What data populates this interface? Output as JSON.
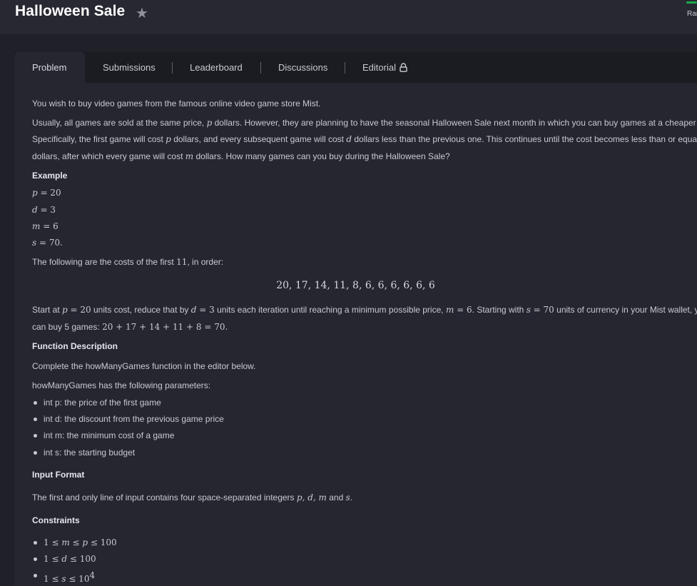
{
  "header": {
    "title": "Halloween Sale",
    "star_icon": "star-icon",
    "rank_label": "Ran"
  },
  "tabs": [
    {
      "label": "Problem"
    },
    {
      "label": "Submissions"
    },
    {
      "label": "Leaderboard"
    },
    {
      "label": "Discussions"
    },
    {
      "label": "Editorial"
    }
  ],
  "problem": {
    "intro": "You wish to buy video games from the famous online video game store Mist.",
    "para1": {
      "l1a": "Usually, all games are sold at the same price, ",
      "l1p": "p",
      "l1b": " dollars. However, they are planning to have the seasonal Halloween Sale next month in which you can buy games at a cheaper price.",
      "l2a": "Specifically, the first game will cost ",
      "l2p": "p",
      "l2b": " dollars, and every subsequent game will cost ",
      "l2d": "d",
      "l2c": " dollars less than the previous one. This continues until the cost becomes less than or equal to ",
      "l2m": "m",
      "l3m": "m",
      "l3a": "dollars, after which every game will cost ",
      "l3b": " dollars. How many games can you buy during the Halloween Sale?"
    },
    "example_heading": "Example",
    "example_vals": [
      {
        "var": "p",
        "val": " = 20"
      },
      {
        "var": "d",
        "val": " = 3"
      },
      {
        "var": "m",
        "val": " = 6"
      },
      {
        "var": "s",
        "val": " = 70."
      }
    ],
    "costs_text_a": "The following are the costs of the first ",
    "costs_text_n": "11",
    "costs_text_b": ", in order:",
    "costs_formula": "20, 17, 14, 11, 8, 6, 6, 6, 6, 6, 6",
    "start": {
      "a": "Start at ",
      "p": "p",
      "b": " = 20",
      "c": " units cost, reduce that by ",
      "d": "d",
      "e": " = 3",
      "f": " units each iteration until reaching a minimum possible price, ",
      "m": "m",
      "g": " = 6",
      "h": ". Starting with ",
      "s": "s",
      "i": " = 70",
      "j": " units of currency in your Mist wallet, you",
      "k": "can buy 5 games: ",
      "sum": "20 + 17 + 14 + 11 + 8 = 70."
    },
    "function_heading": "Function Description",
    "function_text": "Complete the howManyGames function in the editor below.",
    "params_intro": "howManyGames has the following parameters:",
    "params": [
      "int p: the price of the first game",
      "int d: the discount from the previous game price",
      "int m: the minimum cost of a game",
      "int s: the starting budget"
    ],
    "input_heading": "Input Format",
    "input_text_a": "The first and only line of input contains four space-separated integers ",
    "input_vars": "p, d, m",
    "input_text_and": " and ",
    "input_s": "s",
    "input_dot": ".",
    "constraints_heading": "Constraints",
    "constraints": [
      {
        "pre": "1 ≤ ",
        "v1": "m",
        "mid": " ≤ ",
        "v2": "p",
        "post": " ≤ 100"
      },
      {
        "pre": "1 ≤ ",
        "v1": "d",
        "mid": " ≤ 100",
        "v2": "",
        "post": ""
      },
      {
        "pre": "1 ≤ ",
        "v1": "s",
        "mid": " ≤ 10",
        "v2": "",
        "post": "",
        "sup": "4"
      }
    ]
  },
  "colors": {
    "background": "#202128",
    "panel": "#252630",
    "header": "#272831",
    "accent": "#1ba94c"
  }
}
